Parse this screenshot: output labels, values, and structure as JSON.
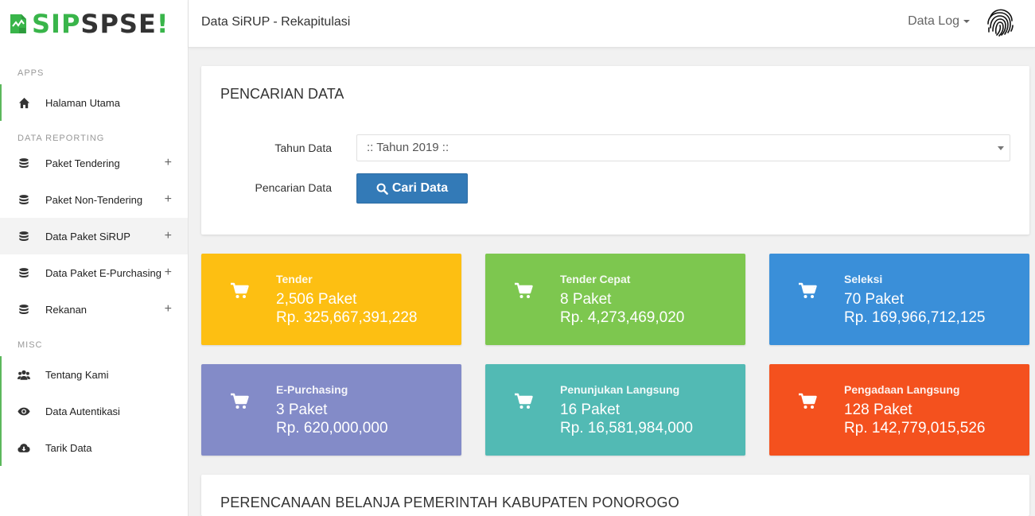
{
  "brand": {
    "sip": "SIP",
    "spse": "SPSE",
    "exclaim": "!"
  },
  "sidebar": {
    "sections": [
      {
        "label": "APPS"
      },
      {
        "label": "DATA REPORTING"
      },
      {
        "label": "MISC"
      }
    ],
    "items": [
      {
        "label": "Halaman Utama",
        "icon": "home-icon"
      },
      {
        "label": "Paket Tendering",
        "icon": "database-icon",
        "expand": "+"
      },
      {
        "label": "Paket Non-Tendering",
        "icon": "database-icon",
        "expand": "+"
      },
      {
        "label": "Data Paket SiRUP",
        "icon": "database-icon",
        "expand": "+"
      },
      {
        "label": "Data Paket E-Purchasing",
        "icon": "database-icon",
        "expand": "+"
      },
      {
        "label": "Rekanan",
        "icon": "database-icon",
        "expand": "+"
      },
      {
        "label": "Tentang Kami",
        "icon": "users-icon"
      },
      {
        "label": "Data Autentikasi",
        "icon": "eye-icon"
      },
      {
        "label": "Tarik Data",
        "icon": "cloud-download-icon"
      }
    ]
  },
  "header": {
    "title": "Data SiRUP - Rekapitulasi",
    "data_log": "Data Log"
  },
  "search": {
    "title": "PENCARIAN DATA",
    "year_label": "Tahun Data",
    "year_value": ":: Tahun 2019 ::",
    "search_label": "Pencarian Data",
    "button_label": "Cari Data"
  },
  "tiles": [
    {
      "title": "Tender",
      "paket": "2,506 Paket",
      "amount": "Rp. 325,667,391,228",
      "color": "#fdbf12"
    },
    {
      "title": "Tender Cepat",
      "paket": "8 Paket",
      "amount": "Rp. 4,273,469,020",
      "color": "#7dc74f"
    },
    {
      "title": "Seleksi",
      "paket": "70 Paket",
      "amount": "Rp. 169,966,712,125",
      "color": "#3a8fd9"
    },
    {
      "title": "E-Purchasing",
      "paket": "3 Paket",
      "amount": "Rp. 620,000,000",
      "color": "#838bc8"
    },
    {
      "title": "Penunjukan Langsung",
      "paket": "16 Paket",
      "amount": "Rp. 16,581,984,000",
      "color": "#52bab4"
    },
    {
      "title": "Pengadaan Langsung",
      "paket": "128 Paket",
      "amount": "Rp. 142,779,015,526",
      "color": "#f4511e"
    }
  ],
  "bottom": {
    "title": "PERENCANAAN BELANJA PEMERINTAH KABUPATEN PONOROGO"
  },
  "colors": {
    "accent_green": "#39b54a",
    "nav_marker": "#5cb85c",
    "primary_button": "#337ab7"
  }
}
